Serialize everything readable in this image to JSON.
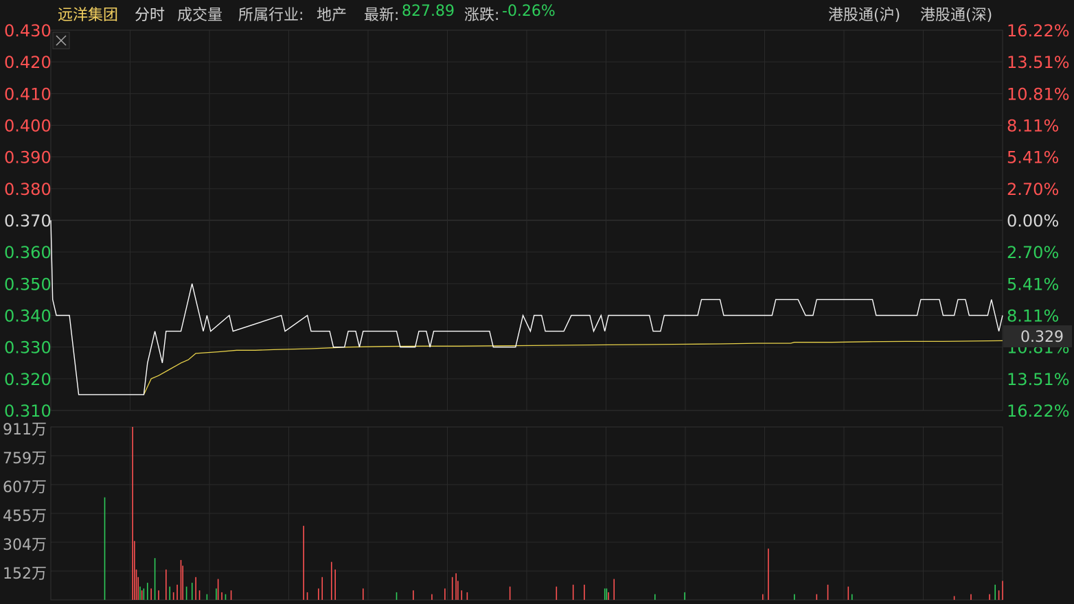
{
  "header": {
    "stock_name": "远洋集团",
    "mode_label": "分时",
    "volume_label": "成交量",
    "industry_label": "所属行业:",
    "industry_value": "地产",
    "latest_label": "最新:",
    "latest_value": "827.89",
    "change_label": "涨跌:",
    "change_value": "-0.26%",
    "connect_sh": "港股通(沪)",
    "connect_sz": "港股通(深)"
  },
  "colors": {
    "background": "#161616",
    "grid": "#2a2a2a",
    "up": "#ff5252",
    "down": "#2ecc5a",
    "flat": "#d8d8d8",
    "price_line": "#ffffff",
    "avg_line": "#e8d24a",
    "stock_name": "#f3d060"
  },
  "chart_data": {
    "type": "line",
    "prev_close": 0.37,
    "current_price": "0.329",
    "price_axis_labels": [
      "0.430",
      "0.420",
      "0.410",
      "0.400",
      "0.390",
      "0.380",
      "0.370",
      "0.360",
      "0.350",
      "0.340",
      "0.330",
      "0.320",
      "0.310"
    ],
    "pct_axis_labels": [
      "16.22%",
      "13.51%",
      "10.81%",
      "8.11%",
      "5.41%",
      "2.70%",
      "0.00%",
      "2.70%",
      "5.41%",
      "8.11%",
      "10.81%",
      "13.51%",
      "16.22%"
    ],
    "volume_axis_labels": [
      "911万",
      "759万",
      "607万",
      "455万",
      "304万",
      "152万"
    ],
    "price": [
      [
        0,
        0.37
      ],
      [
        1,
        0.345
      ],
      [
        3,
        0.34
      ],
      [
        10,
        0.34
      ],
      [
        12,
        0.33
      ],
      [
        15,
        0.315
      ],
      [
        50,
        0.315
      ],
      [
        52,
        0.325
      ],
      [
        54,
        0.33
      ],
      [
        56,
        0.335
      ],
      [
        58,
        0.33
      ],
      [
        60,
        0.325
      ],
      [
        62,
        0.335
      ],
      [
        70,
        0.335
      ],
      [
        72,
        0.34
      ],
      [
        74,
        0.345
      ],
      [
        76,
        0.35
      ],
      [
        78,
        0.345
      ],
      [
        80,
        0.34
      ],
      [
        82,
        0.335
      ],
      [
        84,
        0.34
      ],
      [
        86,
        0.335
      ],
      [
        96,
        0.34
      ],
      [
        98,
        0.335
      ],
      [
        124,
        0.34
      ],
      [
        126,
        0.335
      ],
      [
        138,
        0.34
      ],
      [
        140,
        0.335
      ],
      [
        150,
        0.335
      ],
      [
        152,
        0.33
      ],
      [
        158,
        0.33
      ],
      [
        160,
        0.335
      ],
      [
        164,
        0.335
      ],
      [
        166,
        0.33
      ],
      [
        168,
        0.335
      ],
      [
        186,
        0.335
      ],
      [
        188,
        0.33
      ],
      [
        196,
        0.33
      ],
      [
        198,
        0.335
      ],
      [
        202,
        0.335
      ],
      [
        204,
        0.33
      ],
      [
        206,
        0.335
      ],
      [
        236,
        0.335
      ],
      [
        238,
        0.33
      ],
      [
        250,
        0.33
      ],
      [
        254,
        0.34
      ],
      [
        258,
        0.335
      ],
      [
        260,
        0.34
      ],
      [
        264,
        0.34
      ],
      [
        266,
        0.335
      ],
      [
        276,
        0.335
      ],
      [
        280,
        0.34
      ],
      [
        290,
        0.34
      ],
      [
        292,
        0.335
      ],
      [
        296,
        0.34
      ],
      [
        298,
        0.335
      ],
      [
        300,
        0.34
      ],
      [
        322,
        0.34
      ],
      [
        324,
        0.335
      ],
      [
        328,
        0.335
      ],
      [
        330,
        0.34
      ],
      [
        348,
        0.34
      ],
      [
        350,
        0.345
      ],
      [
        360,
        0.345
      ],
      [
        362,
        0.34
      ],
      [
        388,
        0.34
      ],
      [
        390,
        0.345
      ],
      [
        402,
        0.345
      ],
      [
        406,
        0.34
      ],
      [
        410,
        0.34
      ],
      [
        412,
        0.345
      ],
      [
        442,
        0.345
      ],
      [
        444,
        0.34
      ],
      [
        466,
        0.34
      ],
      [
        468,
        0.345
      ],
      [
        478,
        0.345
      ],
      [
        480,
        0.34
      ],
      [
        486,
        0.34
      ],
      [
        488,
        0.345
      ],
      [
        492,
        0.345
      ],
      [
        494,
        0.34
      ],
      [
        504,
        0.34
      ],
      [
        506,
        0.345
      ],
      [
        508,
        0.34
      ],
      [
        510,
        0.335
      ],
      [
        512,
        0.34
      ]
    ],
    "avg_price": [
      [
        50,
        0.315
      ],
      [
        54,
        0.32
      ],
      [
        58,
        0.321
      ],
      [
        64,
        0.323
      ],
      [
        70,
        0.325
      ],
      [
        74,
        0.326
      ],
      [
        78,
        0.328
      ],
      [
        90,
        0.3285
      ],
      [
        100,
        0.329
      ],
      [
        110,
        0.329
      ],
      [
        120,
        0.3292
      ],
      [
        140,
        0.3295
      ],
      [
        160,
        0.33
      ],
      [
        180,
        0.3302
      ],
      [
        200,
        0.3303
      ],
      [
        220,
        0.3303
      ],
      [
        240,
        0.3304
      ],
      [
        260,
        0.3305
      ],
      [
        280,
        0.3306
      ],
      [
        300,
        0.3307
      ],
      [
        320,
        0.3308
      ],
      [
        340,
        0.3309
      ],
      [
        360,
        0.331
      ],
      [
        380,
        0.3312
      ],
      [
        398,
        0.3312
      ],
      [
        400,
        0.3315
      ],
      [
        420,
        0.3315
      ],
      [
        440,
        0.3317
      ],
      [
        460,
        0.3318
      ],
      [
        480,
        0.3318
      ],
      [
        512,
        0.332
      ]
    ],
    "volume": [
      [
        29,
        5400000,
        "down"
      ],
      [
        44,
        9110000,
        "up"
      ],
      [
        45,
        3100000,
        "up"
      ],
      [
        46,
        1600000,
        "up"
      ],
      [
        47,
        1200000,
        "up"
      ],
      [
        48,
        700000,
        "down"
      ],
      [
        49,
        500000,
        "up"
      ],
      [
        50,
        600000,
        "down"
      ],
      [
        52,
        900000,
        "down"
      ],
      [
        54,
        600000,
        "up"
      ],
      [
        56,
        2200000,
        "down"
      ],
      [
        58,
        500000,
        "up"
      ],
      [
        62,
        1600000,
        "up"
      ],
      [
        64,
        700000,
        "down"
      ],
      [
        66,
        400000,
        "up"
      ],
      [
        68,
        800000,
        "up"
      ],
      [
        70,
        2100000,
        "up"
      ],
      [
        71,
        1800000,
        "up"
      ],
      [
        73,
        700000,
        "down"
      ],
      [
        76,
        900000,
        "down"
      ],
      [
        78,
        1200000,
        "up"
      ],
      [
        80,
        500000,
        "up"
      ],
      [
        84,
        300000,
        "down"
      ],
      [
        89,
        600000,
        "down"
      ],
      [
        90,
        1100000,
        "up"
      ],
      [
        92,
        400000,
        "up"
      ],
      [
        94,
        300000,
        "down"
      ],
      [
        97,
        500000,
        "up"
      ],
      [
        136,
        3900000,
        "up"
      ],
      [
        138,
        400000,
        "up"
      ],
      [
        144,
        600000,
        "up"
      ],
      [
        146,
        1200000,
        "up"
      ],
      [
        151,
        2000000,
        "up"
      ],
      [
        153,
        1600000,
        "up"
      ],
      [
        168,
        600000,
        "up"
      ],
      [
        186,
        400000,
        "down"
      ],
      [
        195,
        500000,
        "up"
      ],
      [
        205,
        300000,
        "up"
      ],
      [
        212,
        600000,
        "up"
      ],
      [
        216,
        1200000,
        "up"
      ],
      [
        218,
        1400000,
        "up"
      ],
      [
        219,
        1000000,
        "up"
      ],
      [
        221,
        500000,
        "up"
      ],
      [
        224,
        400000,
        "up"
      ],
      [
        247,
        700000,
        "up"
      ],
      [
        272,
        700000,
        "up"
      ],
      [
        281,
        800000,
        "up"
      ],
      [
        287,
        800000,
        "up"
      ],
      [
        298,
        600000,
        "down"
      ],
      [
        299,
        600000,
        "down"
      ],
      [
        300,
        400000,
        "up"
      ],
      [
        303,
        1100000,
        "up"
      ],
      [
        325,
        300000,
        "down"
      ],
      [
        341,
        400000,
        "down"
      ],
      [
        383,
        300000,
        "up"
      ],
      [
        386,
        2700000,
        "up"
      ],
      [
        400,
        300000,
        "down"
      ],
      [
        412,
        300000,
        "up"
      ],
      [
        418,
        800000,
        "up"
      ],
      [
        429,
        700000,
        "up"
      ],
      [
        431,
        300000,
        "down"
      ],
      [
        486,
        200000,
        "up"
      ],
      [
        495,
        300000,
        "up"
      ],
      [
        505,
        300000,
        "up"
      ],
      [
        508,
        800000,
        "down"
      ],
      [
        510,
        500000,
        "up"
      ],
      [
        512,
        1000000,
        "up"
      ]
    ]
  }
}
